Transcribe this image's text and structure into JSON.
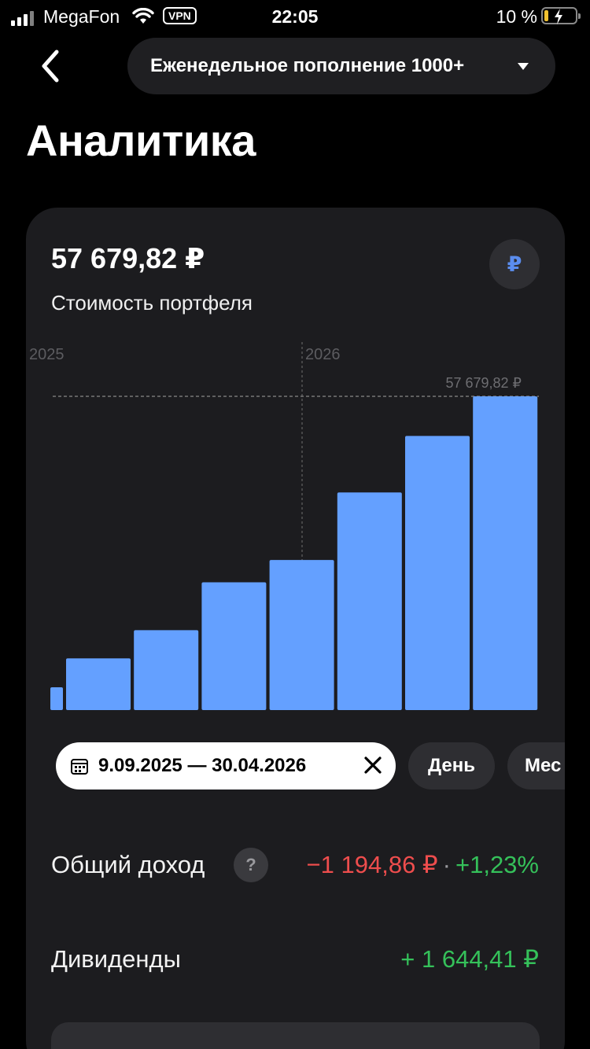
{
  "status_bar": {
    "carrier": "MegaFon",
    "vpn": "VPN",
    "time": "22:05",
    "battery": "10 %",
    "battery_level": 0.1
  },
  "header": {
    "portfolio_name": "Еженедельное пополнение 1000+",
    "title": "Аналитика"
  },
  "card": {
    "value": "57 679,82 ₽",
    "subtitle": "Стоимость портфеля",
    "currency_symbol": "₽"
  },
  "chart_data": {
    "type": "bar",
    "title": "",
    "xlabel": "",
    "ylabel": "",
    "x_ticks": [
      "2025",
      "2026"
    ],
    "reference_label": "57 679,82 ₽",
    "reference_value": 57679.82,
    "values": [
      4200,
      9500,
      14700,
      23500,
      27600,
      40000,
      50400,
      57679.82
    ],
    "bar_color": "#64a0ff",
    "grid": false
  },
  "filters": {
    "date_range": "9.09.2025 — 30.04.2026",
    "day": "День",
    "month": "Мес"
  },
  "stats": {
    "income_label": "Общий доход",
    "help": "?",
    "income_value": "−1 194,86 ₽",
    "separator": "·",
    "income_percent": "+1,23%",
    "dividends_label": "Дивиденды",
    "dividends_value": "+ 1 644,41 ₽"
  },
  "colors": {
    "accent": "#5b8dee",
    "negative": "#ee4d4d",
    "positive": "#35c15a",
    "card_bg": "#1c1c1f"
  }
}
